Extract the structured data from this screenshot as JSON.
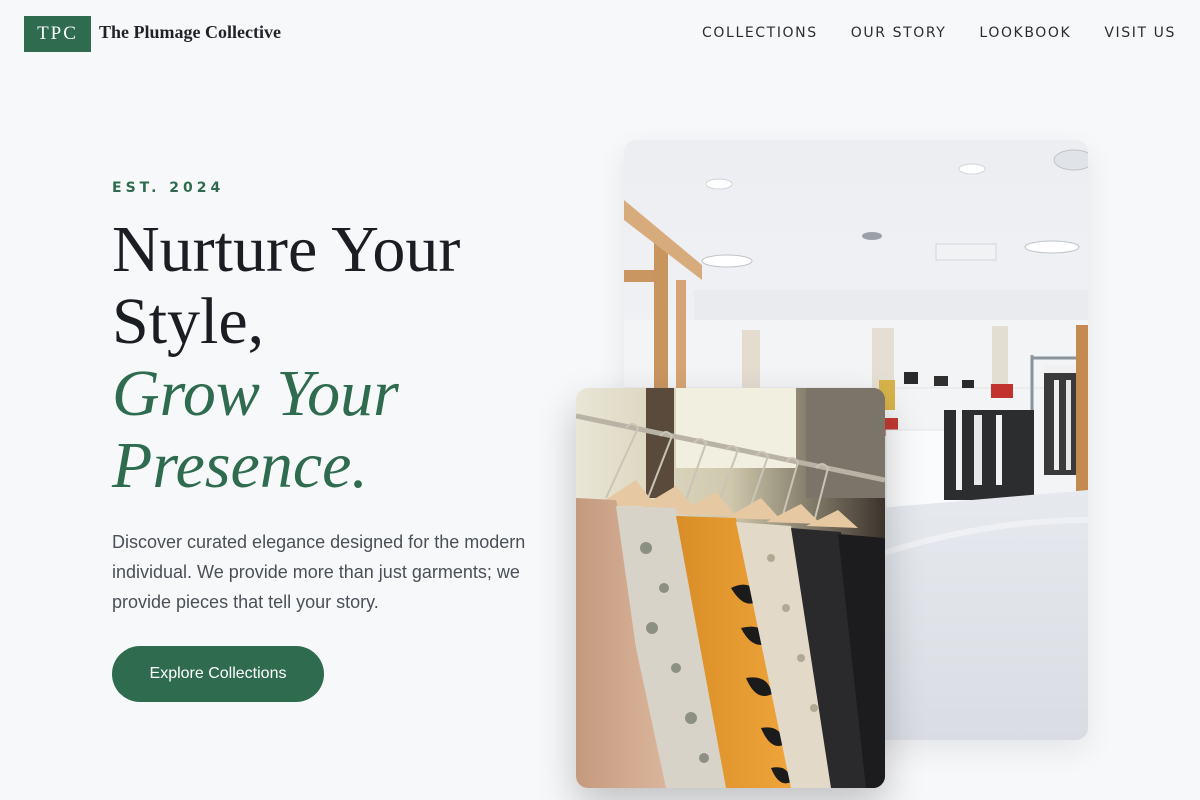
{
  "header": {
    "logo_text": "TPC",
    "brand_name": "The Plumage Collective",
    "nav": [
      "COLLECTIONS",
      "OUR STORY",
      "LOOKBOOK",
      "VISIT US"
    ]
  },
  "hero": {
    "eyebrow": "EST. 2024",
    "headline_line1": "Nurture Your",
    "headline_line2": "Style,",
    "headline_accent_line1": "Grow Your",
    "headline_accent_line2": "Presence.",
    "description": "Discover curated elegance designed for the modern individual. We provide more than just garments; we provide pieces that tell your story.",
    "cta_label": "Explore Collections"
  },
  "colors": {
    "brand_green": "#2e6b4f",
    "background": "#f7f8fa"
  }
}
